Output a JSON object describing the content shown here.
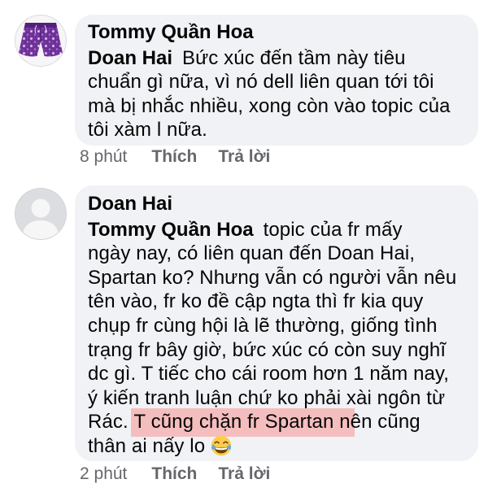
{
  "colors": {
    "page_background": "#ffffff",
    "bubble_background": "#f0f2f5",
    "text": "#050505",
    "meta_text": "#65676b",
    "highlight": "#f5bebe"
  },
  "comments": [
    {
      "avatar_icon": "purple-floral-shorts-avatar",
      "author": "Tommy Quần Hoa",
      "mention": "Doan Hai",
      "first_line": "Bức xúc đến tầm này tiêu",
      "lines": [
        "chuẩn gì nữa, vì nó dell liên quan tới tôi",
        "mà bị nhắc nhiều, xong còn vào topic của",
        "tôi xàm l nữa."
      ],
      "time": "8 phút",
      "like_label": "Thích",
      "reply_label": "Trả lời"
    },
    {
      "avatar_icon": "default-profile-silhouette-avatar",
      "author": "Doan Hai",
      "mention": "Tommy Quần Hoa",
      "first_line": "topic của fr mấy",
      "lines": [
        "ngày nay, có liên quan đến Doan Hai,",
        "Spartan ko? Nhưng vẫn có người vẫn nêu",
        "tên vào, fr ko đề cập ngta thì fr kia quy",
        "chụp fr cùng hội là lẽ thường, giống tình",
        "trạng fr bây giờ, bức xúc có còn suy nghĩ",
        "dc gì. T tiếc cho cái room hơn 1 năm nay,",
        "ý kiến tranh luận chứ ko phải xài ngôn từ"
      ],
      "highlighted_line": {
        "before": "Rác. ",
        "highlighted": "T cũng chặn fr Spartan",
        "after": " nên cũng"
      },
      "last_line": "thân ai nấy lo",
      "emoji_icon": "face-with-tears-of-joy-icon",
      "time": "2 phút",
      "like_label": "Thích",
      "reply_label": "Trả lời"
    }
  ]
}
